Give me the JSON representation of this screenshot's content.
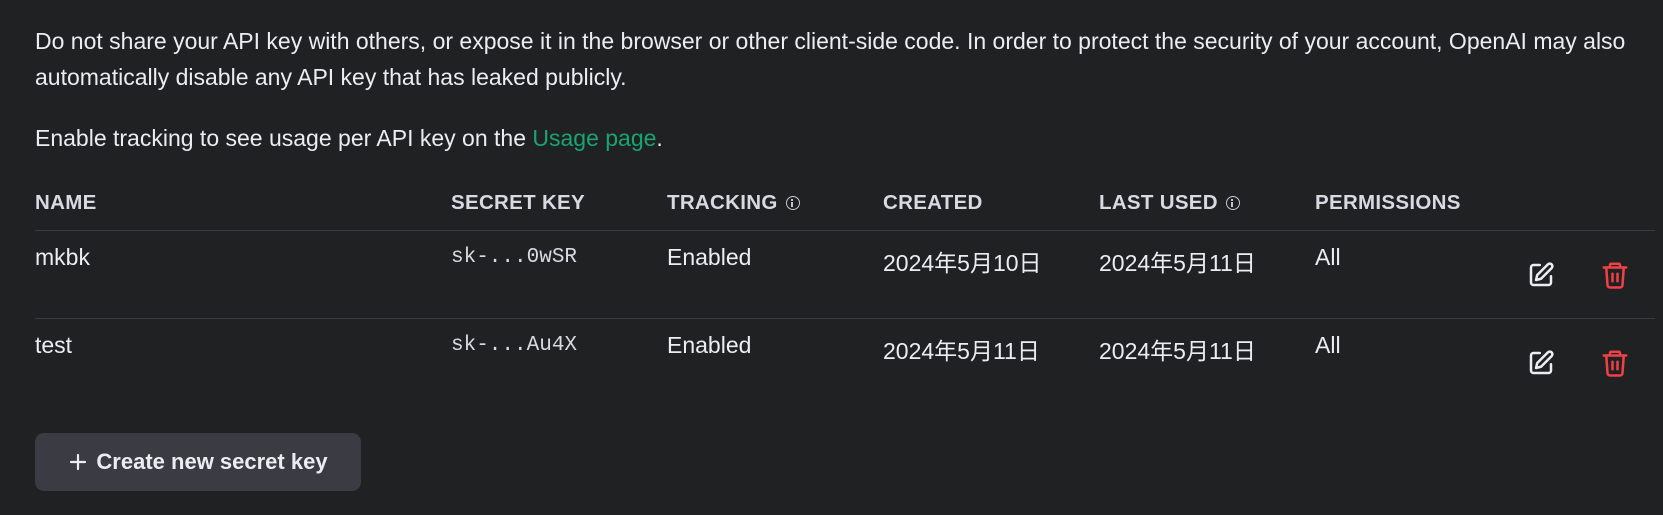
{
  "notice": {
    "warning_text": "Do not share your API key with others, or expose it in the browser or other client-side code. In order to protect the security of your account, OpenAI may also automatically disable any API key that has leaked publicly.",
    "tracking_prefix": "Enable tracking to see usage per API key on the ",
    "usage_link": "Usage page",
    "tracking_suffix": "."
  },
  "table": {
    "headers": {
      "name": "NAME",
      "secret_key": "SECRET KEY",
      "tracking": "TRACKING",
      "created": "CREATED",
      "last_used": "LAST USED",
      "permissions": "PERMISSIONS"
    },
    "rows": [
      {
        "name": "mkbk",
        "secret_key": "sk-...0wSR",
        "tracking": "Enabled",
        "created": "2024年5月10日",
        "last_used": "2024年5月11日",
        "permissions": "All"
      },
      {
        "name": "test",
        "secret_key": "sk-...Au4X",
        "tracking": "Enabled",
        "created": "2024年5月11日",
        "last_used": "2024年5月11日",
        "permissions": "All"
      }
    ]
  },
  "actions": {
    "create_label": "Create new secret key"
  },
  "icons": {
    "tracking_info": "info-icon",
    "last_used_info": "info-icon",
    "edit": "pencil-edit-icon",
    "delete": "trash-icon",
    "create": "plus-icon"
  },
  "colors": {
    "background": "#202123",
    "link": "#19a472",
    "delete": "#ef4146",
    "button": "#3a3b43"
  }
}
